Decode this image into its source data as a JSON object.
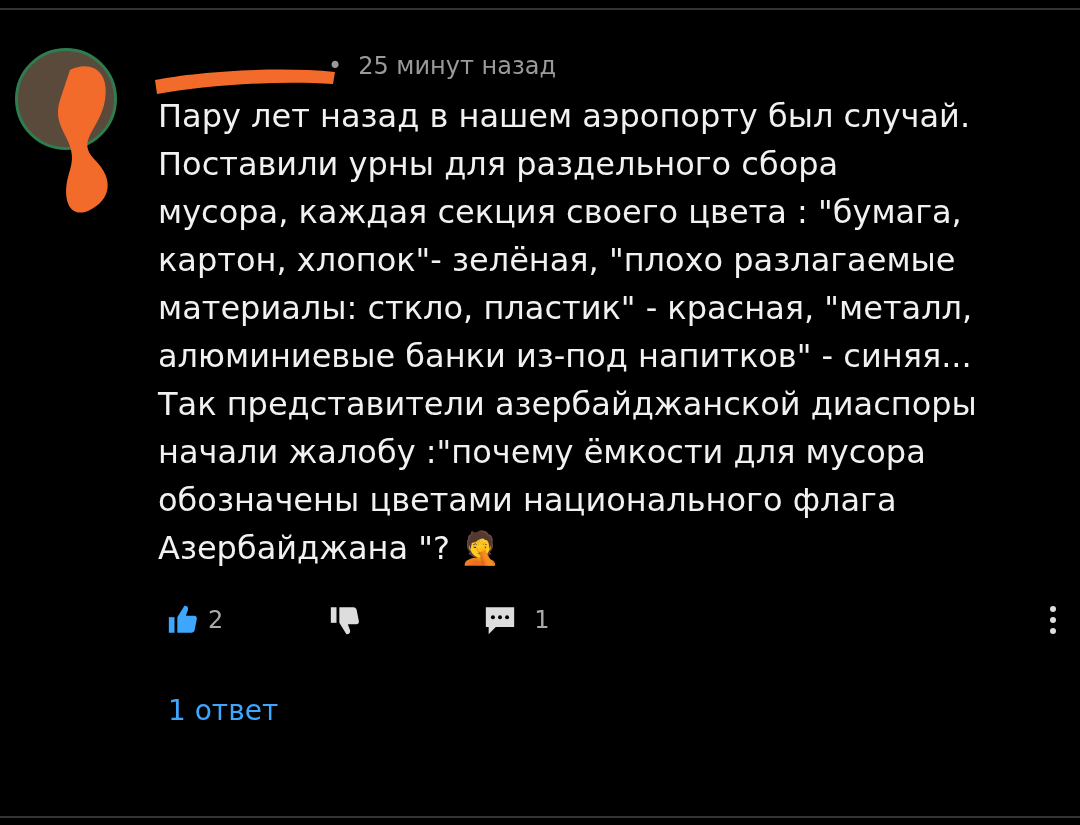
{
  "comment": {
    "separator": "•",
    "time": "25 минут назад",
    "text": "Пару лет назад в нашем аэропорту был случай.\nПоставили урны для раздельного сбора\nмусора, каждая секция своего цвета : \"бумага,\nкартон, хлопок\"- зелёная, \"плохо разлагаемые\nматериалы: сткло, пластик\" - красная, \"металл,\nалюминиевые банки из-под напитков\" - синяя...\nТак представители азербайджанской диаспоры\nначали жалобу :\"почему ёмкости для мусора\nобозначены цветами национального флага\nАзербайджана \"? 🤦",
    "likes": "2",
    "liked": true,
    "disliked": false,
    "replies_count": "1",
    "replies_link": "1 ответ"
  }
}
